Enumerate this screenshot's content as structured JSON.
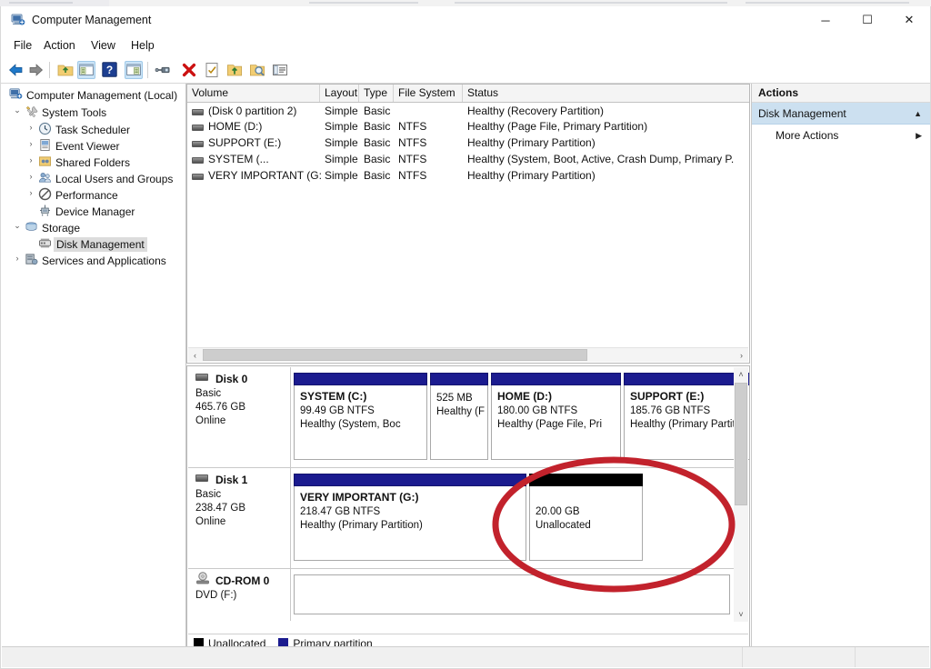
{
  "window": {
    "title": "Computer Management",
    "icon": "computer-management-icon",
    "minimize": "─",
    "maximize": "☐",
    "close": "✕"
  },
  "menu": [
    "File",
    "Action",
    "View",
    "Help"
  ],
  "toolbar": {
    "items": [
      {
        "name": "back-icon",
        "selected": false
      },
      {
        "name": "forward-icon",
        "selected": false
      },
      {
        "name": "up-folder-icon",
        "selected": false
      },
      {
        "name": "show-hide-console-tree-icon",
        "selected": true
      },
      {
        "name": "help-icon",
        "selected": false
      },
      {
        "name": "show-hide-action-pane-icon",
        "selected": true
      },
      {
        "name": "connect-icon",
        "selected": false
      },
      {
        "name": "delete-icon",
        "selected": false
      },
      {
        "name": "properties-icon",
        "selected": false
      },
      {
        "name": "export-list-icon",
        "selected": false
      },
      {
        "name": "rescan-disks-icon",
        "selected": false
      },
      {
        "name": "show-details-icon",
        "selected": false
      }
    ]
  },
  "tree": {
    "root": {
      "label": "Computer Management (Local)",
      "icon": "computer-icon"
    },
    "items": [
      {
        "label": "System Tools",
        "icon": "system-tools-icon",
        "indent": 1,
        "expander": "expanded",
        "selected": false
      },
      {
        "label": "Task Scheduler",
        "icon": "clock-icon",
        "indent": 2,
        "expander": "collapsed",
        "selected": false
      },
      {
        "label": "Event Viewer",
        "icon": "event-viewer-icon",
        "indent": 2,
        "expander": "collapsed",
        "selected": false
      },
      {
        "label": "Shared Folders",
        "icon": "shared-folders-icon",
        "indent": 2,
        "expander": "collapsed",
        "selected": false
      },
      {
        "label": "Local Users and Groups",
        "icon": "users-icon",
        "indent": 2,
        "expander": "collapsed",
        "selected": false
      },
      {
        "label": "Performance",
        "icon": "performance-icon",
        "indent": 2,
        "expander": "collapsed",
        "selected": false
      },
      {
        "label": "Device Manager",
        "icon": "device-manager-icon",
        "indent": 2,
        "expander": "none",
        "selected": false
      },
      {
        "label": "Storage",
        "icon": "storage-icon",
        "indent": 1,
        "expander": "expanded",
        "selected": false
      },
      {
        "label": "Disk Management",
        "icon": "disk-management-icon",
        "indent": 2,
        "expander": "none",
        "selected": true
      },
      {
        "label": "Services and Applications",
        "icon": "services-icon",
        "indent": 1,
        "expander": "collapsed",
        "selected": false
      }
    ]
  },
  "volume_list": {
    "columns": [
      "Volume",
      "Layout",
      "Type",
      "File System",
      "Status"
    ],
    "rows": [
      {
        "volume": "(Disk 0 partition 2)",
        "layout": "Simple",
        "type": "Basic",
        "fs": "",
        "status": "Healthy (Recovery Partition)"
      },
      {
        "volume": "HOME (D:)",
        "layout": "Simple",
        "type": "Basic",
        "fs": "NTFS",
        "status": "Healthy (Page File, Primary Partition)"
      },
      {
        "volume": "SUPPORT (E:)",
        "layout": "Simple",
        "type": "Basic",
        "fs": "NTFS",
        "status": "Healthy (Primary Partition)"
      },
      {
        "volume": "SYSTEM (...",
        "layout": "Simple",
        "type": "Basic",
        "fs": "NTFS",
        "status": "Healthy (System, Boot, Active, Crash Dump, Primary P."
      },
      {
        "volume": "VERY IMPORTANT (G:)",
        "layout": "Simple",
        "type": "Basic",
        "fs": "NTFS",
        "status": "Healthy (Primary Partition)"
      }
    ],
    "hscroll": {
      "left_arrow": "‹",
      "right_arrow": "›"
    }
  },
  "disk_view": {
    "scroll": {
      "up_arrow": "˄",
      "down_arrow": "˅"
    },
    "disks": [
      {
        "name": "Disk 0",
        "icon": "disk-icon",
        "type": "Basic",
        "size": "465.76 GB",
        "state": "Online",
        "partitions": [
          {
            "title": "SYSTEM  (C:)",
            "size": "99.49 GB NTFS",
            "status": "Healthy (System, Boc",
            "kind": "primary"
          },
          {
            "title": "",
            "size": "525 MB",
            "status": "Healthy (F",
            "kind": "primary"
          },
          {
            "title": "HOME  (D:)",
            "size": "180.00 GB NTFS",
            "status": "Healthy (Page File, Pri",
            "kind": "primary"
          },
          {
            "title": "SUPPORT  (E:)",
            "size": "185.76 GB NTFS",
            "status": "Healthy (Primary Partit",
            "kind": "primary"
          }
        ]
      },
      {
        "name": "Disk 1",
        "icon": "disk-icon",
        "type": "Basic",
        "size": "238.47 GB",
        "state": "Online",
        "partitions": [
          {
            "title": "VERY IMPORTANT  (G:)",
            "size": "218.47 GB NTFS",
            "status": "Healthy (Primary Partition)",
            "kind": "primary"
          },
          {
            "title": "",
            "size": "20.00 GB",
            "status": "Unallocated",
            "kind": "unallocated"
          }
        ]
      },
      {
        "name": "CD-ROM 0",
        "icon": "cdrom-icon",
        "type": "DVD (F:)",
        "size": "",
        "state": "",
        "partitions": [
          {
            "title": "",
            "size": "",
            "status": "",
            "kind": "empty"
          }
        ]
      }
    ],
    "legend": [
      {
        "label": "Unallocated",
        "color": "#000000"
      },
      {
        "label": "Primary partition",
        "color": "#1b1b8f"
      }
    ]
  },
  "actions": {
    "header": "Actions",
    "group": {
      "label": "Disk Management",
      "chevron": "▲"
    },
    "items": [
      {
        "label": "More Actions",
        "arrow": "▶"
      }
    ]
  },
  "annotation": {
    "shape": "red-ellipse-highlight",
    "color": "#c2222c",
    "target": "unallocated-space-disk-1"
  },
  "colors": {
    "primary_partition": "#1b1b8f",
    "unallocated": "#000000",
    "selection": "#dcdcdc",
    "actions_highlight": "#cce0f0",
    "annotation_red": "#c2222c"
  }
}
